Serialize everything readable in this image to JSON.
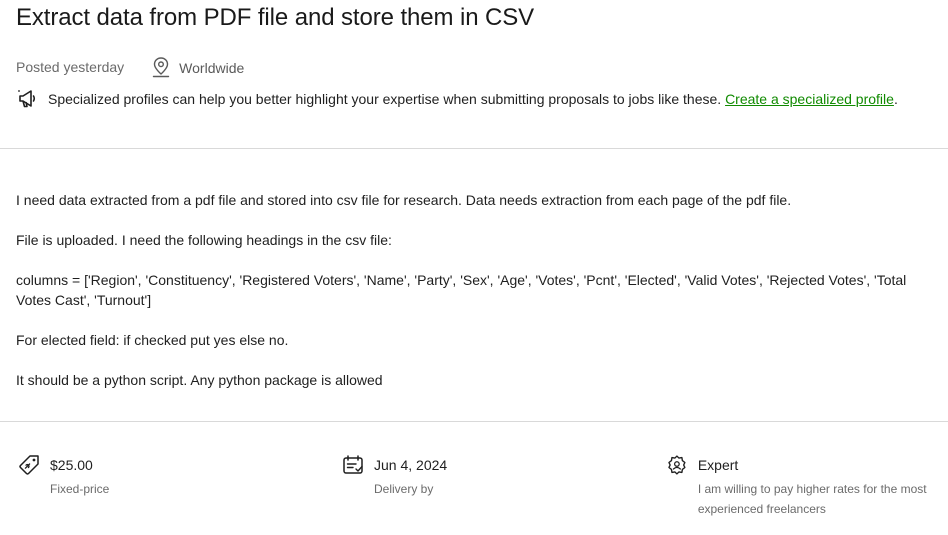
{
  "job": {
    "title": "Extract data from PDF file and store them in CSV",
    "posted": "Posted yesterday",
    "location": "Worldwide"
  },
  "promo": {
    "text": "Specialized profiles can help you better highlight your expertise when submitting proposals to jobs like these.",
    "link": "Create a specialized profile",
    "trailing": "."
  },
  "description": {
    "paragraphs": [
      "I need data extracted from a pdf file and stored into csv file for research. Data needs extraction from each page of the pdf file.",
      "File is uploaded. I need the following headings in the csv file:",
      "columns = ['Region', 'Constituency', 'Registered Voters', 'Name', 'Party', 'Sex', 'Age', 'Votes', 'Pcnt', 'Elected', 'Valid Votes', 'Rejected Votes', 'Total Votes Cast', 'Turnout']",
      "For elected field: if checked put yes else no.",
      "It should be a python script. Any python package is allowed"
    ]
  },
  "stats": {
    "price": {
      "value": "$25.00",
      "label": "Fixed-price",
      "icon": "price-tag-icon"
    },
    "delivery": {
      "value": "Jun 4, 2024",
      "label": "Delivery by",
      "icon": "calendar-icon"
    },
    "level": {
      "value": "Expert",
      "label": "I am willing to pay higher rates for the most experienced freelancers",
      "icon": "expertise-icon"
    }
  },
  "colors": {
    "link": "#108a00",
    "text": "#1f1f1f",
    "muted": "#6b6b6b",
    "divider": "#d9d9d9"
  }
}
